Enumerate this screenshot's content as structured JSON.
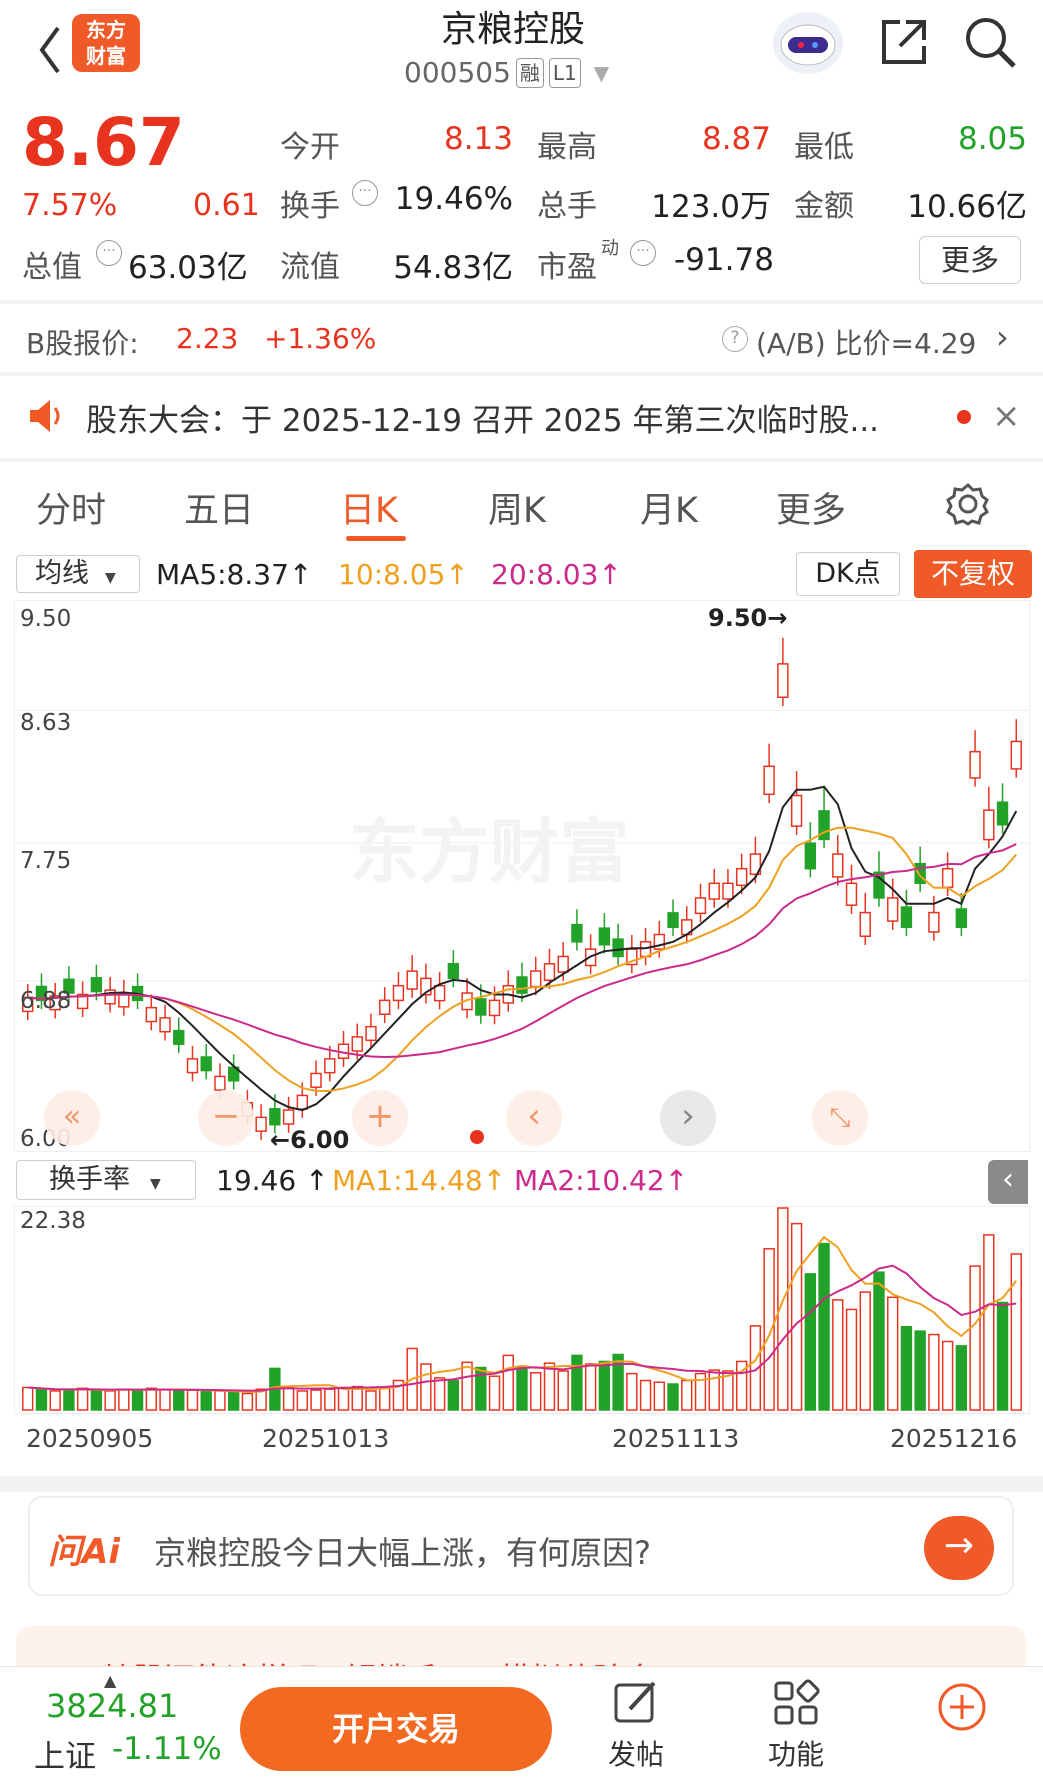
{
  "header": {
    "back": "‹",
    "logo_line1": "东方",
    "logo_line2": "财富",
    "title": "京粮控股",
    "code": "000505",
    "tag_rong": "融",
    "tag_level": "L1"
  },
  "quote": {
    "price": "8.67",
    "change_pct": "7.57%",
    "change": "0.61",
    "open_label": "今开",
    "open": "8.13",
    "high_label": "最高",
    "high": "8.87",
    "low_label": "最低",
    "low": "8.05",
    "turnover_label": "换手",
    "turnover": "19.46%",
    "volume_label": "总手",
    "volume": "123.0万",
    "amount_label": "金额",
    "amount": "10.66亿",
    "mktcap_label": "总值",
    "mktcap": "63.03亿",
    "float_label": "流值",
    "float": "54.83亿",
    "pe_label": "市盈",
    "pe_sup": "动",
    "pe": "-91.78",
    "more": "更多"
  },
  "bshare": {
    "label": "B股报价:",
    "price": "2.23",
    "pct": "+1.36%",
    "ratio": "(A/B) 比价=4.29"
  },
  "notice": {
    "text": "股东大会：于 2025-12-19 召开 2025 年第三次临时股..."
  },
  "tabs": [
    "分时",
    "五日",
    "日K",
    "周K",
    "月K",
    "更多"
  ],
  "active_tab": "日K",
  "kline": {
    "ma_selector": "均线",
    "ma5": "MA5:8.37",
    "ma10": "10:8.05",
    "ma20": "20:8.03",
    "dk": "DK点",
    "fq": "不复权",
    "y_labels": [
      "9.50",
      "8.63",
      "7.75",
      "6.88",
      "6.00"
    ],
    "high_mark": "9.50",
    "low_mark": "6.00",
    "watermark": "东方财富"
  },
  "turnover_chart": {
    "selector": "换手率",
    "value": "19.46",
    "ma1": "MA1:14.48",
    "ma2": "MA2:10.42",
    "y_max": "22.38",
    "dates": [
      "20250905",
      "20251013",
      "20251113",
      "20251216"
    ]
  },
  "chart_data": {
    "type": "bar",
    "title": "",
    "ylabel": "换手率",
    "ylim": [
      0,
      22.38
    ],
    "values": [
      2.6,
      2.4,
      2.2,
      2.3,
      2.5,
      2.3,
      2.2,
      2.4,
      2.3,
      2.5,
      2.4,
      2.2,
      2.3,
      2.1,
      2.2,
      2.0,
      1.9,
      2.4,
      4.8,
      2.6,
      2.2,
      2.3,
      2.4,
      2.6,
      2.7,
      2.2,
      2.5,
      3.4,
      7.1,
      5.3,
      3.7,
      3.4,
      5.5,
      4.9,
      3.9,
      6.3,
      4.9,
      4.3,
      5.4,
      4.5,
      6.3,
      5.3,
      5.6,
      6.4,
      4.2,
      3.4,
      3.2,
      3.0,
      3.4,
      4.2,
      4.6,
      4.5,
      5.6,
      9.7,
      18.6,
      24.7,
      21.5,
      15.7,
      19.2,
      12.7,
      11.6,
      13.6,
      15.9,
      13.0,
      9.6,
      9.1,
      8.7,
      7.9,
      7.4,
      16.6,
      20.2,
      12.4,
      18.0
    ],
    "up": [
      1,
      0,
      1,
      0,
      1,
      0,
      1,
      1,
      0,
      1,
      1,
      0,
      1,
      0,
      1,
      0,
      1,
      1,
      0,
      1,
      1,
      1,
      1,
      1,
      1,
      1,
      1,
      1,
      1,
      1,
      1,
      0,
      1,
      0,
      1,
      1,
      0,
      1,
      1,
      1,
      0,
      1,
      0,
      0,
      1,
      1,
      1,
      0,
      1,
      1,
      1,
      1,
      1,
      1,
      1,
      1,
      1,
      0,
      0,
      1,
      1,
      1,
      0,
      1,
      0,
      0,
      1,
      1,
      0,
      1,
      1,
      0,
      1
    ]
  },
  "ai_bar": {
    "logo": "问Ai",
    "question": "京粮控股今日大幅上涨，有何原因?"
  },
  "promo": {
    "text": "炒股还能这样玩? 解锁千万元模拟体验金!"
  },
  "bottom": {
    "index_value": "3824.81",
    "index_name": "上证",
    "index_change": "-1.11%",
    "trade": "开户交易",
    "post": "发帖",
    "func": "功能"
  }
}
